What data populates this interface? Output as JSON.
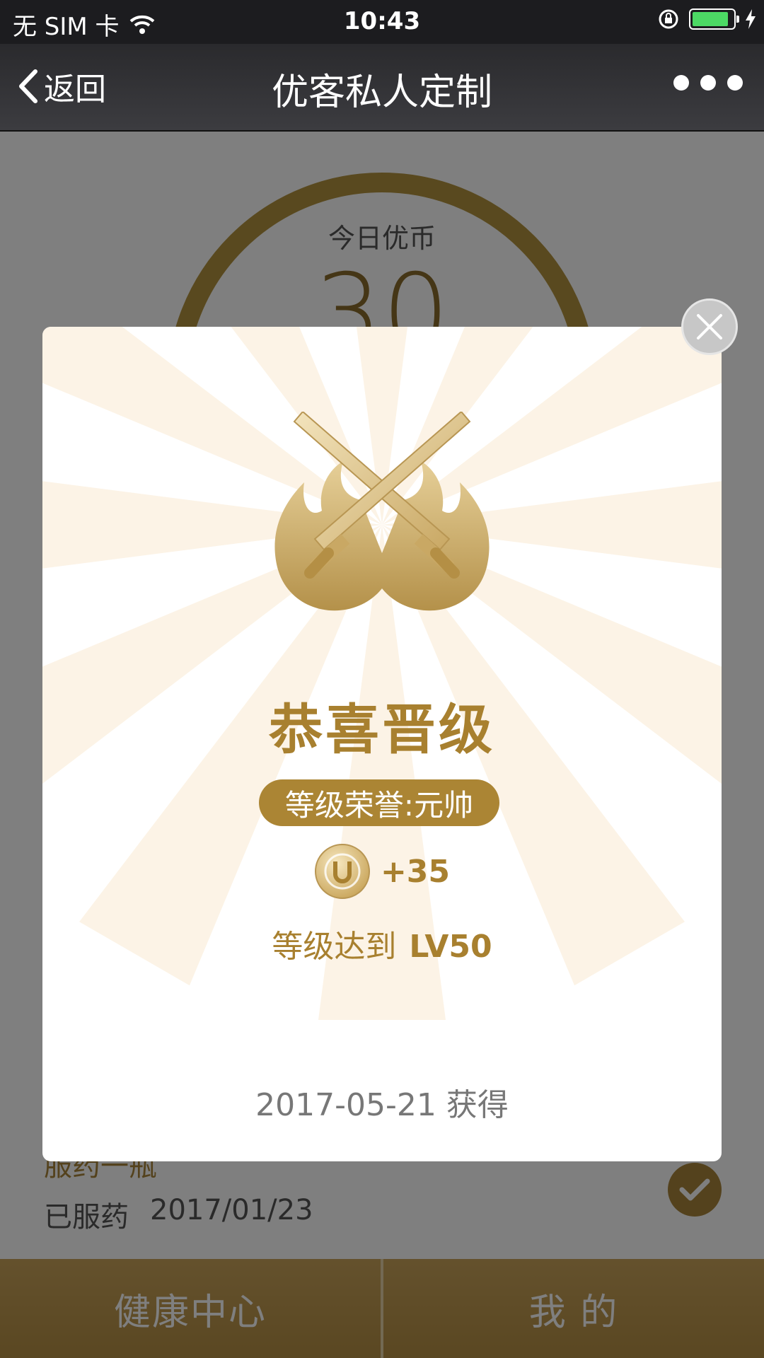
{
  "status_bar": {
    "carrier": "无 SIM 卡",
    "time": "10:43",
    "battery_level": 0.9
  },
  "nav": {
    "back_label": "返回",
    "title": "优客私人定制"
  },
  "home": {
    "coin_label": "今日优币",
    "coin_count": "30",
    "record": {
      "title": "服药一瓶",
      "status": "已服药",
      "date": "2017/01/23"
    }
  },
  "tabs": [
    {
      "label": "健康中心"
    },
    {
      "label": "我 的"
    }
  ],
  "modal": {
    "title": "恭喜晋级",
    "honor_badge": "等级荣誉:元帅",
    "reward": "+35",
    "level_prefix": "等级达到",
    "level_value": "LV50",
    "date_line": "2017-05-21 获得"
  },
  "colors": {
    "gold": "#a8802f",
    "badge": "#ab8534",
    "tabbar": "#b58f44"
  },
  "icons": [
    "chevron-left-icon",
    "more-dots-icon",
    "wifi-icon",
    "orientation-lock-icon",
    "battery-icon",
    "charging-bolt-icon",
    "crossed-swords-badge-icon",
    "u-coin-icon",
    "check-icon",
    "close-icon"
  ]
}
